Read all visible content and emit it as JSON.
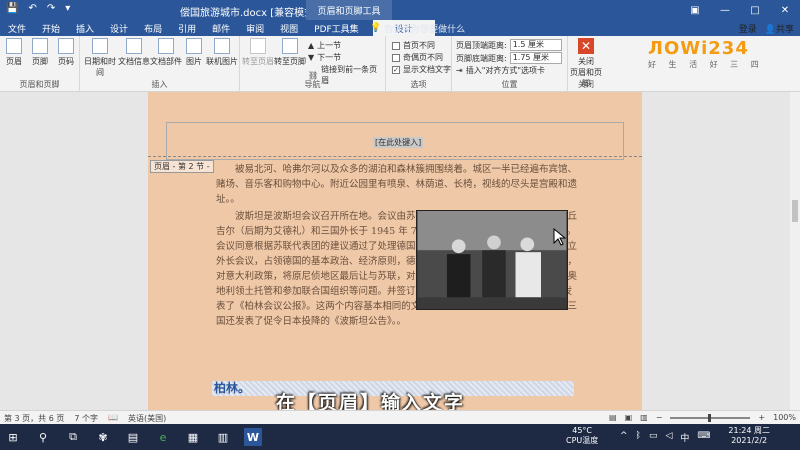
{
  "titlebar": {
    "qat": [
      "💾",
      "↶",
      "↷",
      "▾"
    ],
    "title": "偿国旅游城市.docx [兼容模式] - Word",
    "context_tab": "页眉和页脚工具",
    "controls": [
      "▣",
      "—",
      "□",
      "✕"
    ]
  },
  "menubar": {
    "tabs": [
      "文件",
      "开始",
      "插入",
      "设计",
      "布局",
      "引用",
      "邮件",
      "审阅",
      "视图",
      "PDF工具集",
      "设计"
    ],
    "active_index": 10,
    "search_hint": "告诉我你想要做什么",
    "login": "登录",
    "share": "共享"
  },
  "ribbon": {
    "groups": [
      "页眉和页脚",
      "插入",
      "导航",
      "选项",
      "位置",
      "关闭"
    ],
    "hf_buttons": [
      "页眉",
      "页脚",
      "页码"
    ],
    "insert_buttons": [
      "日期和时间",
      "文档信息",
      "文档部件",
      "图片",
      "联机图片"
    ],
    "nav_buttons": [
      "转至页眉",
      "转至页脚"
    ],
    "nav_small": [
      "上一节",
      "下一节",
      "链接到前一条页眉"
    ],
    "options": [
      {
        "label": "首页不同",
        "checked": false
      },
      {
        "label": "奇偶页不同",
        "checked": false
      },
      {
        "label": "显示文档文字",
        "checked": true
      }
    ],
    "position": {
      "header_label": "页眉顶端距离:",
      "header_value": "1.5 厘米",
      "footer_label": "页脚底端距离:",
      "footer_value": "1.75 厘米",
      "align_tab": "插入\"对齐方式\"选项卡"
    },
    "close_button": "关闭\n页眉和页脚"
  },
  "logo": {
    "text": "ЛОWi234",
    "sub": "好 生 活 好 三 四"
  },
  "document": {
    "header_placeholder": "[在此处键入]",
    "section_tag": "页眉 - 第 2 节 -",
    "paragraphs": [
      "被易北河、哈弗尔河以及众多的湖泊和森林簇拥围绕着。城区一半已经遍布宾馆、赌场、音乐客和购物中心。附近公园里有喷泉、林荫道、长椅，视线的尽头是宫殿和遗址。。",
      "波斯坦是波斯坦会议召开所在地。会议由苏、美、英三国首脑斯大林、杜鲁门、丘吉尔（后期为艾德礼）和三国外长于 1945 年 7 月 17 日到 8 月 2 日在波斯坦举行。会议同意根据苏联代表团的建议通过了处理德国问题的原则和其他有关决定，包括设立外长会议，占领德国的基本政治、经济原则，德国赔偿，波兰西部疆界，控制黑海峡，对意大利政策，将原尼侦地区最后让与苏联，对罗、保、匈、芬的政策，战争罪犯，奥地利领土托管和参加联合国组织等问题。并签订了《柏林（波斯坦）会议议定书》，发表了《柏林会议公报》。这两个内容基本相同的文件通称《波斯坦协定》。中、美、英三国还发表了促令日本投降的《波斯坦公告》。。"
    ],
    "heading": "柏林。"
  },
  "caption": "在【页眉】输入文字",
  "status": {
    "page": "第 3 页，共 6 页",
    "words": "7 个字",
    "lang": "英语(美国)",
    "zoom": "100%"
  },
  "taskbar": {
    "icons": [
      "⊞",
      "⚲",
      "⧉",
      "✾",
      "▤",
      "e",
      "▦",
      "▥",
      "W"
    ],
    "temp": "45°C",
    "temp_label": "CPU温度",
    "ime": "中",
    "time": "21:24 周二",
    "date": "2021/2/2"
  }
}
